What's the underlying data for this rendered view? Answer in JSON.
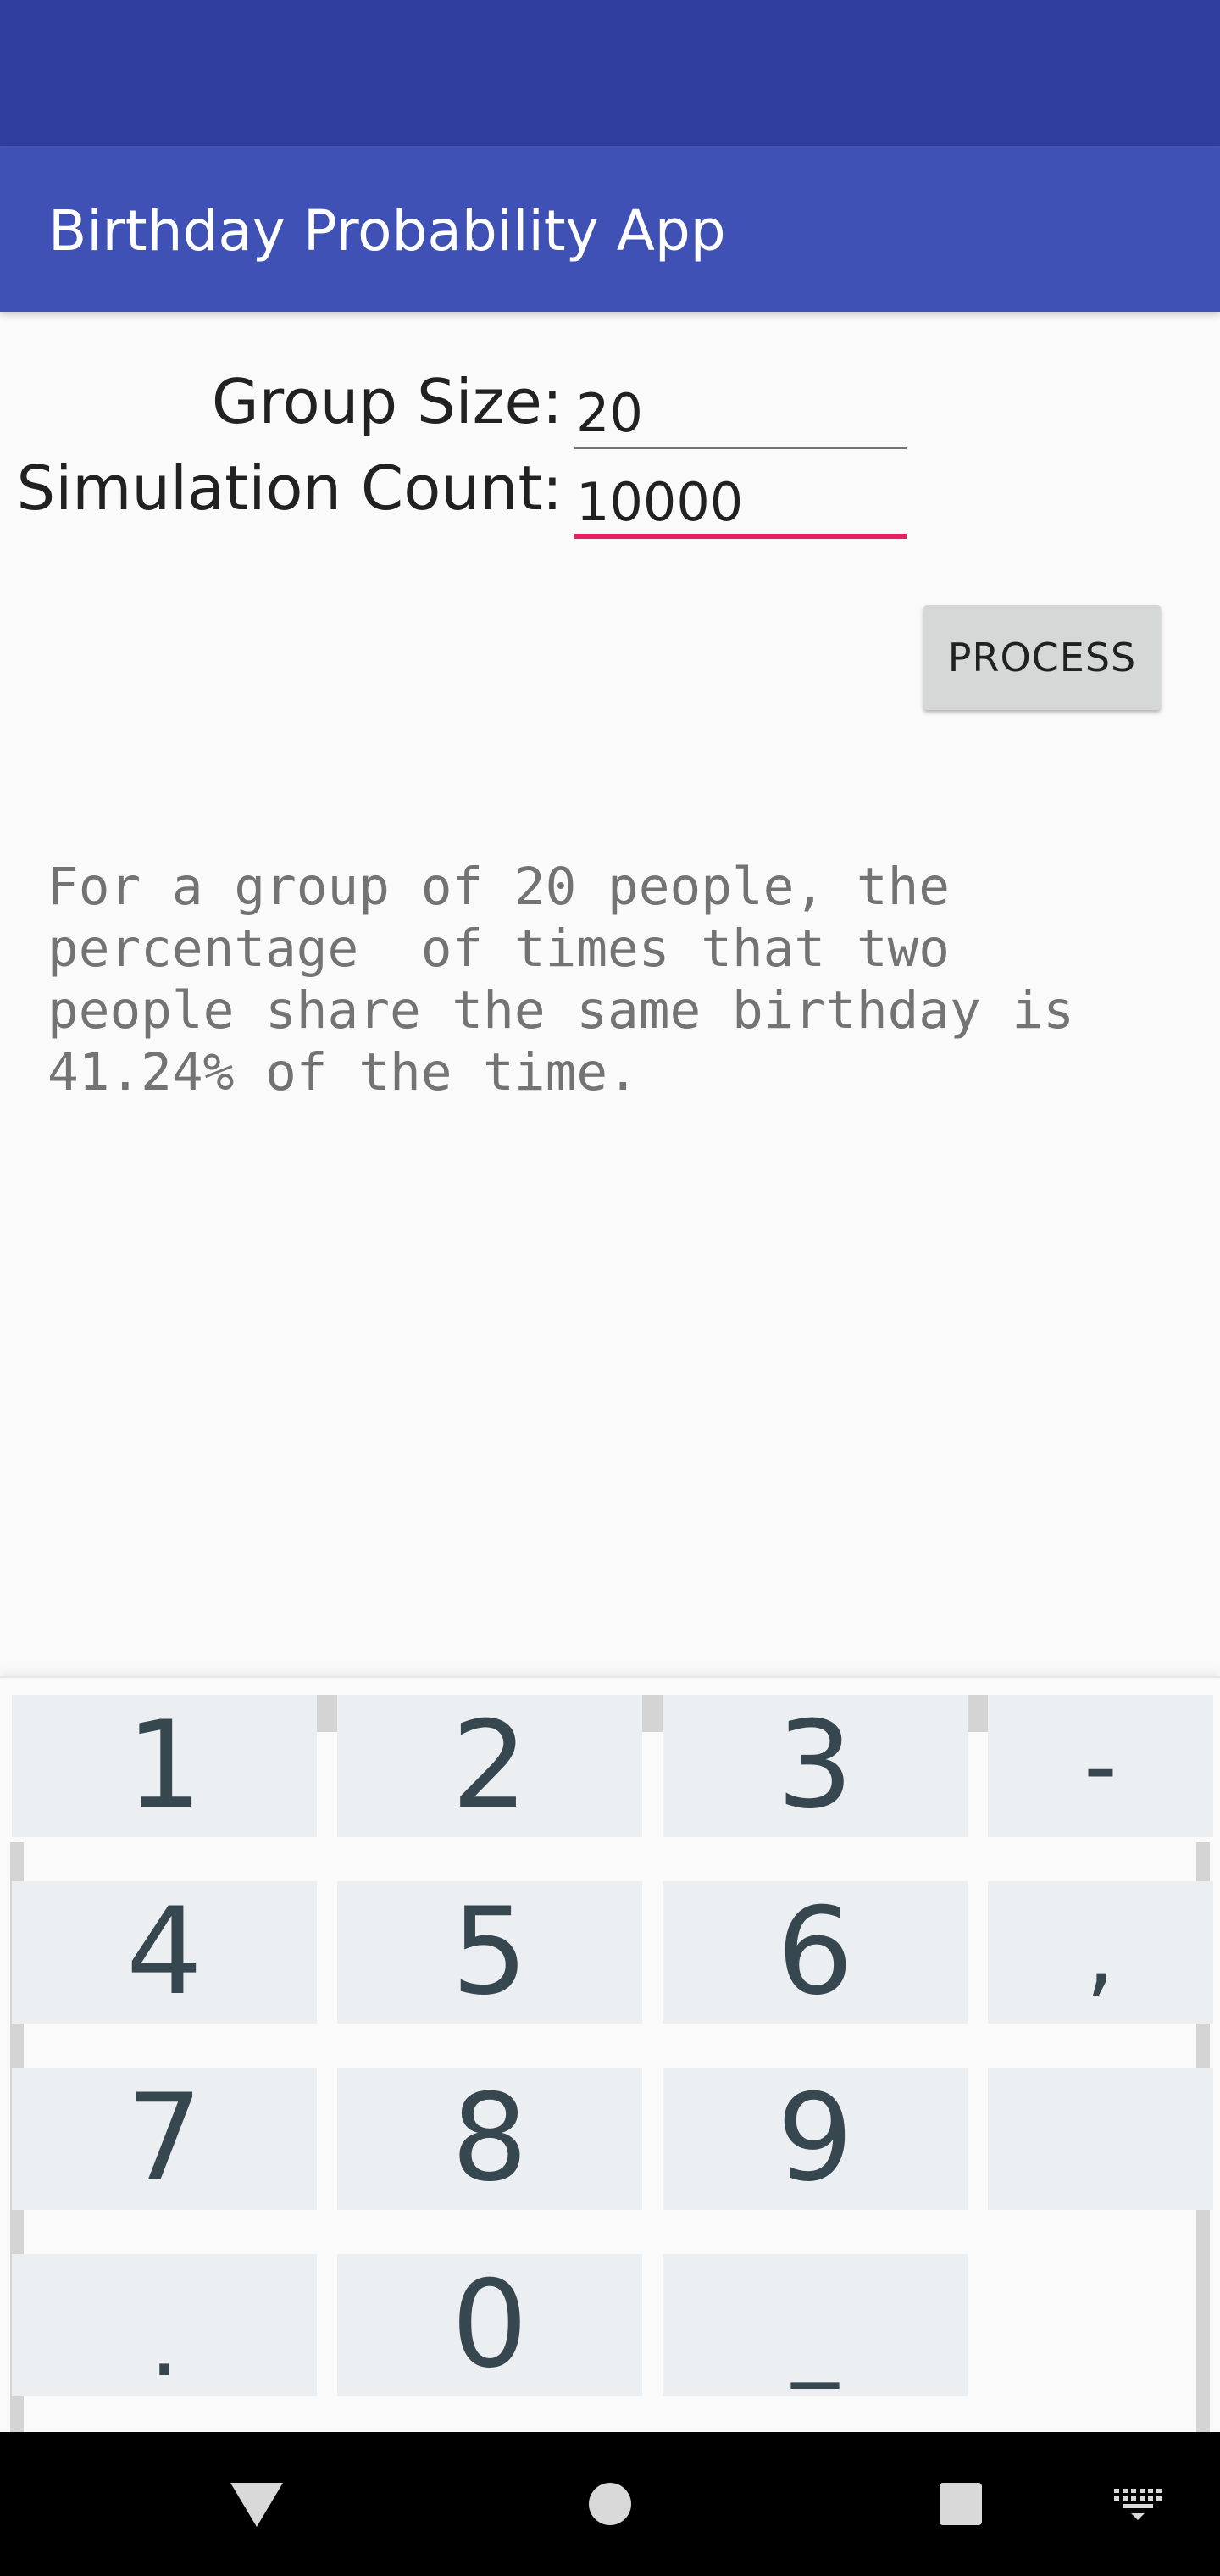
{
  "app": {
    "title": "Birthday Probability App"
  },
  "form": {
    "group_size_label": "Group Size:",
    "group_size_value": "20",
    "simulation_count_label": "Simulation Count:",
    "simulation_count_value": "10000",
    "process_label": "PROCESS"
  },
  "result": {
    "text": "For a group of 20 people, the\npercentage  of times that two\npeople share the same birthday is\n41.24% of the time."
  },
  "keyboard": {
    "keys": [
      "1",
      "2",
      "3",
      "-",
      "4",
      "5",
      "6",
      ",",
      "7",
      "8",
      "9",
      "",
      ".",
      "0",
      "_"
    ]
  },
  "nav": {
    "icons": [
      "back-icon",
      "home-icon",
      "recents-icon",
      "keyboard-switch-icon"
    ]
  },
  "colors": {
    "status_bar": "#303f9f",
    "app_bar": "#3f51b5",
    "accent": "#e91e63",
    "key_bg": "#eceff1",
    "key_text": "#37474f"
  }
}
